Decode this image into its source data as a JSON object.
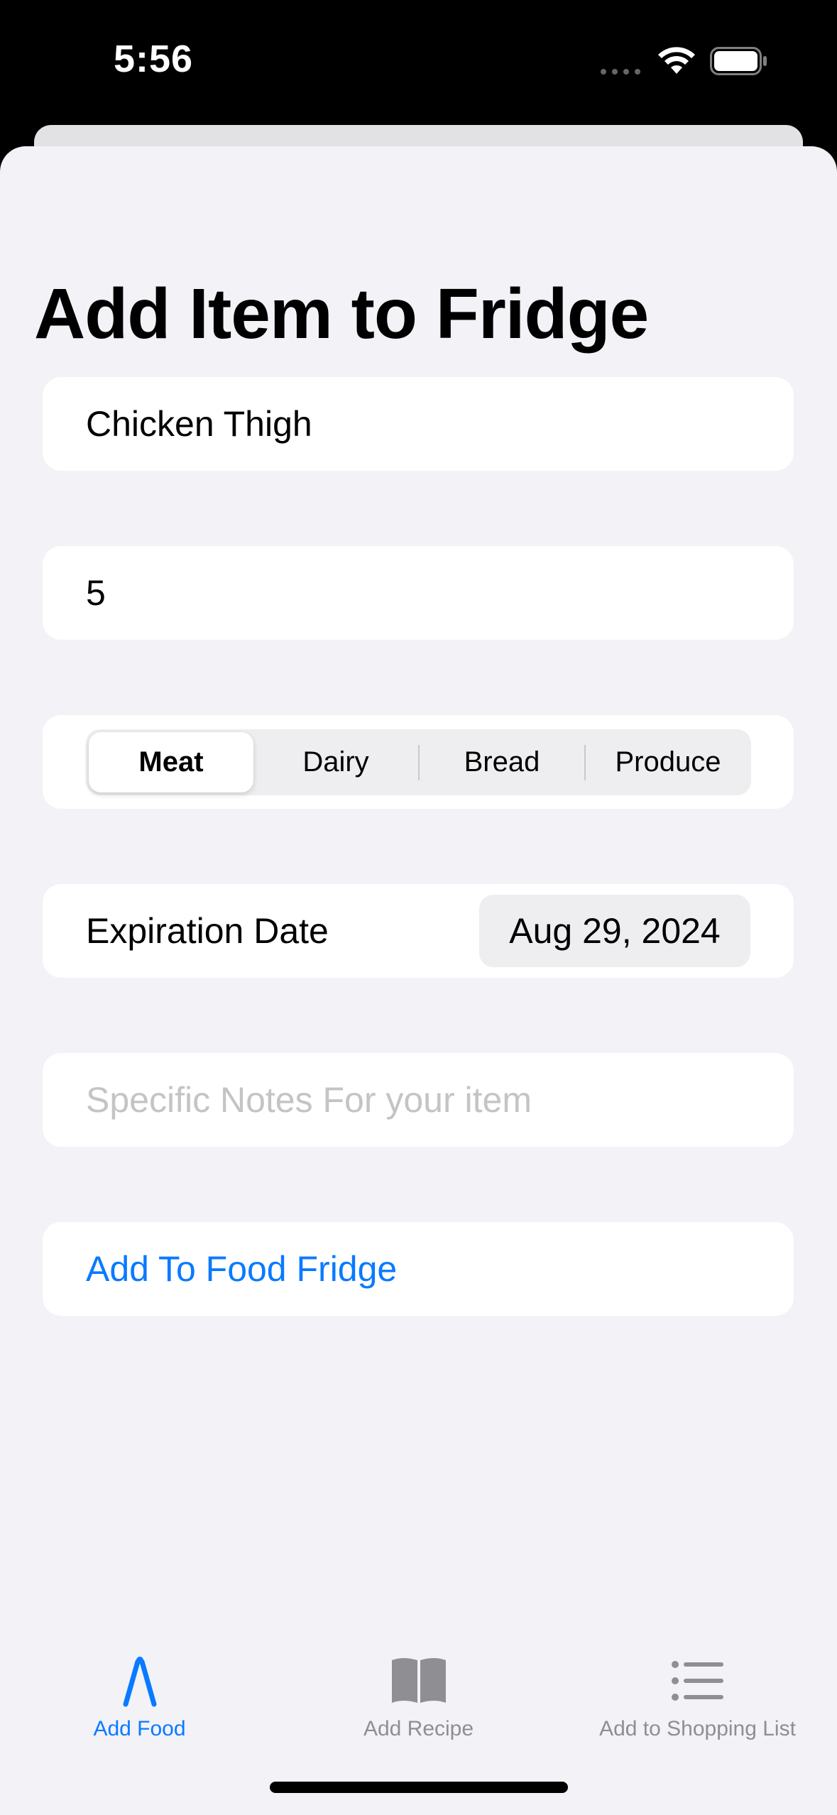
{
  "status_bar": {
    "time": "5:56"
  },
  "title": "Add Item to Fridge",
  "form": {
    "name": {
      "value": "Chicken Thigh"
    },
    "quantity": {
      "value": "5"
    },
    "category": {
      "options": [
        "Meat",
        "Dairy",
        "Bread",
        "Produce"
      ],
      "selected": "Meat"
    },
    "expiration": {
      "label": "Expiration Date",
      "value": "Aug 29, 2024"
    },
    "notes": {
      "placeholder": "Specific Notes For your item"
    },
    "submit_label": "Add To Food Fridge"
  },
  "tab_bar": {
    "items": [
      {
        "label": "Add Food",
        "icon": "compass-icon",
        "selected": true
      },
      {
        "label": "Add Recipe",
        "icon": "book-icon",
        "selected": false
      },
      {
        "label": "Add to Shopping List",
        "icon": "list-icon",
        "selected": false
      }
    ]
  },
  "colors": {
    "accent": "#0a7aff",
    "inactive": "#8e8e93",
    "background": "#f2f2f7",
    "card": "#ffffff"
  }
}
